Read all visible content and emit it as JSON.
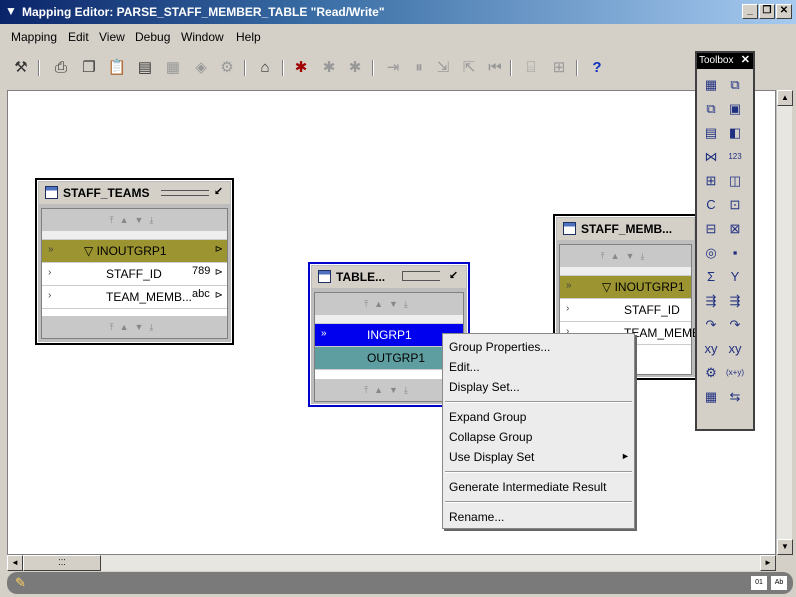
{
  "window": {
    "title": "Mapping Editor: PARSE_STAFF_MEMBER_TABLE \"Read/Write\"",
    "minimize": "_",
    "restore": "❐",
    "close": "✕"
  },
  "menubar": {
    "items": [
      "Mapping",
      "Edit",
      "View",
      "Debug",
      "Window",
      "Help"
    ]
  },
  "toolbar": {
    "icons": [
      "validate-icon",
      "print-icon",
      "copy-icon",
      "paste-icon",
      "properties-icon",
      "generate-icon",
      "deploy-icon",
      "run-icon",
      "tag-icon",
      "debug-icon",
      "debug-step-icon",
      "debug-stop-icon",
      "step-into-icon",
      "pause-icon",
      "step-over-icon",
      "step-out-icon",
      "restart-icon",
      "breakpoint-icon",
      "watch-icon",
      "help-icon"
    ],
    "help_glyph": "?"
  },
  "operators": {
    "staff_teams": {
      "title": "STAFF_TEAMS",
      "group": "INOUTGRP1",
      "rows": [
        {
          "label": "STAFF_ID",
          "type": "789"
        },
        {
          "label": "TEAM_MEMB...",
          "type": "abc"
        }
      ]
    },
    "table_op": {
      "title": "TABLE...",
      "in_group": "INGRP1",
      "out_group": "OUTGRP1"
    },
    "staff_member": {
      "title": "STAFF_MEMB...",
      "group": "INOUTGRP1",
      "rows": [
        {
          "label": "STAFF_ID"
        },
        {
          "label": "TEAM_MEMB"
        }
      ]
    }
  },
  "context_menu": {
    "items": [
      "Group Properties...",
      "Edit...",
      "Display Set...",
      "Expand Group",
      "Collapse Group",
      "Use Display Set",
      "Generate Intermediate Result",
      "Rename..."
    ],
    "submenu_arrow": "►"
  },
  "toolbox": {
    "title": "Toolbox",
    "close": "✕",
    "icons": [
      "table-icon",
      "view-icon",
      "materialized-view-icon",
      "cube-icon",
      "file-icon",
      "dimension-icon",
      "joiner-icon",
      "sequence-icon",
      "mapping-input-icon",
      "lookup-icon",
      "constant-icon",
      "expression-icon",
      "splitter-icon",
      "aggregator-icon",
      "set-operation-icon",
      "filter-icon",
      "sorter-icon",
      "deduplicator-icon",
      "pivot-icon",
      "unpivot-icon",
      "transformation-icon",
      "table-function-icon",
      "xy-input-icon",
      "xy-output-icon",
      "procedure-icon",
      "external-icon",
      "table-function-fx-icon",
      "name-address-icon"
    ],
    "glyphs": {
      "constant": "C",
      "aggregator": "Σ",
      "filter": "Y",
      "sequence": "123",
      "fx": "(x+y)"
    }
  },
  "colors": {
    "titlebar": "#0a246a",
    "group_bar": "#9b9430",
    "selected_group": "#0000ee",
    "out_group": "#5f9ea0"
  }
}
